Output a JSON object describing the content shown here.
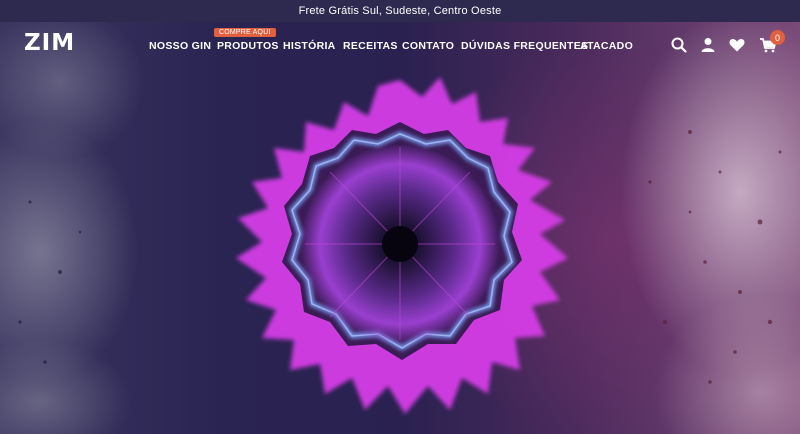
{
  "announcement": {
    "text": "Frete Grátis Sul, Sudeste, Centro Oeste"
  },
  "header": {
    "logo": "ZIM",
    "nav": [
      {
        "label": "NOSSO GIN"
      },
      {
        "label": "PRODUTOS",
        "badge": "COMPRE AQUI"
      },
      {
        "label": "HISTÓRIA"
      },
      {
        "label": "RECEITAS"
      },
      {
        "label": "CONTATO"
      },
      {
        "label": "DÚVIDAS FREQUENTES"
      },
      {
        "label": "ATACADO"
      }
    ],
    "icons": [
      "search-icon",
      "account-icon",
      "wishlist-heart-icon",
      "cart-icon"
    ],
    "cart_count": "0"
  },
  "colors": {
    "announcement_bg": "#2e2a4f",
    "badge": "#e0603f",
    "bloom_magenta": "#d83ee8",
    "bloom_blue": "#7fa8ff"
  }
}
